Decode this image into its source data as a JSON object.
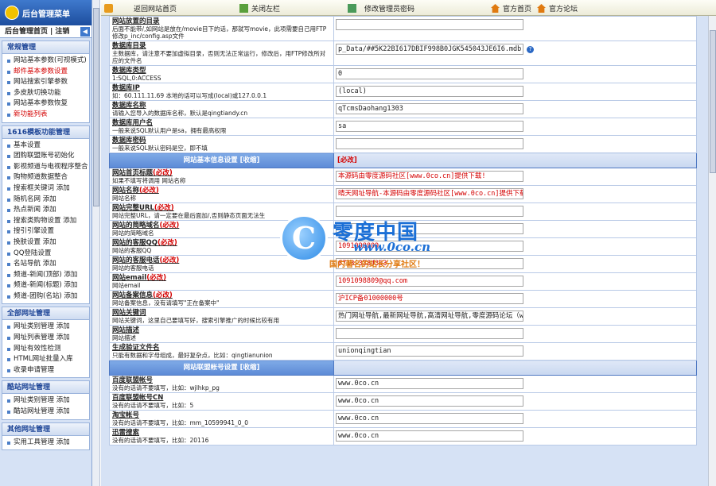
{
  "sidebar": {
    "header": "后台管理菜单",
    "home": "后台管理首页",
    "logout": "注销",
    "groups": [
      {
        "title": "常规管理",
        "items": [
          {
            "label": "网站基本参数(可视模式)",
            "red": false
          },
          {
            "label": "邮件基本参数设置",
            "red": true
          },
          {
            "label": "网站搜索引擎参数",
            "red": false
          },
          {
            "label": "多皮肤切换功能",
            "red": false
          },
          {
            "label": "网站基本参数恢复",
            "red": false
          },
          {
            "label": "新功能列表",
            "red": true
          }
        ]
      },
      {
        "title": "1616模板功能管理",
        "items": [
          {
            "label": "基本设置",
            "red": false
          },
          {
            "label": "团购联盟账号初始化",
            "red": false
          },
          {
            "label": "影视频道与电视程序整合",
            "red": false
          },
          {
            "label": "购物频道数据整合",
            "red": false
          },
          {
            "label": "搜索框关键词  添加",
            "red": false
          },
          {
            "label": "随机名网  添加",
            "red": false
          },
          {
            "label": "热点新闻  添加",
            "red": false
          },
          {
            "label": "搜索类购物设置  添加",
            "red": false
          },
          {
            "label": "搜引引擎设置",
            "red": false
          },
          {
            "label": "换肤设置  添加",
            "red": false
          },
          {
            "label": "QQ登陆设置",
            "red": false
          },
          {
            "label": "名站导航  添加",
            "red": false
          },
          {
            "label": "频道-新闻(顶部)  添加",
            "red": false
          },
          {
            "label": "频道-新闻(标题)  添加",
            "red": false
          },
          {
            "label": "频道-团购(名站)  添加",
            "red": false
          }
        ]
      },
      {
        "title": "全部网址管理",
        "items": [
          {
            "label": "网址类别管理  添加",
            "red": false
          },
          {
            "label": "网址列表管理  添加",
            "red": false
          },
          {
            "label": "网址有效性检测",
            "red": false
          },
          {
            "label": "HTML网址批量入库",
            "red": false
          },
          {
            "label": "收录申请管理",
            "red": false
          }
        ]
      },
      {
        "title": "酷站网址管理",
        "items": [
          {
            "label": "网址类别管理  添加",
            "red": false
          },
          {
            "label": "酷站网址管理  添加",
            "red": false
          }
        ]
      },
      {
        "title": "其他网址管理",
        "items": [
          {
            "label": "实用工具管理  添加",
            "red": false
          }
        ]
      }
    ]
  },
  "topbar": {
    "back": "返回网站首页",
    "close_left": "关闭左栏",
    "change_pwd": "修改管理员密码",
    "official_home": "官方首页",
    "official_forum": "官方论坛"
  },
  "rows": [
    {
      "kind": "field",
      "title": "网站放置的目录",
      "req": "",
      "desc": "后面不能带/,如网站是放在/movie目下的话，那就写movie，此项需要自己用FTP修改p_inc/config.asp文件",
      "value": "",
      "red": false,
      "help": false
    },
    {
      "kind": "field",
      "title": "数据库目录",
      "req": "",
      "desc": "主数据库，请注意不要加虚拟目录，否则无法正常运行，修改后，用FTP修改所对应的文件名",
      "value": "p_Data/##5K22BI617DBIF998B0JGK545043JE6I6.mdb",
      "red": false,
      "help": true
    },
    {
      "kind": "field",
      "title": "数据库类型",
      "req": "",
      "desc": "1:SQL,0:ACCESS",
      "value": "0",
      "red": false,
      "help": false
    },
    {
      "kind": "field",
      "title": "数据库IP",
      "req": "",
      "desc": "如：60.111.11.69 本地的话可以写成(local)或127.0.0.1",
      "value": "(local)",
      "red": false,
      "help": false
    },
    {
      "kind": "field",
      "title": "数据库名称",
      "req": "",
      "desc": "请输入您导入的数据库名称，默认是qingtiandy.cn",
      "value": "qTcmsDaohang1303",
      "red": false,
      "help": false
    },
    {
      "kind": "field",
      "title": "数据库用户名",
      "req": "",
      "desc": "一般来说SQL默认用户是sa，拥有最高权限",
      "value": "sa",
      "red": false,
      "help": false
    },
    {
      "kind": "field",
      "title": "数据库密码",
      "req": "",
      "desc": "一般来说SQL默认密码是空，即不填",
      "value": "",
      "red": false,
      "help": false
    },
    {
      "kind": "section",
      "left": "网站基本信息设置 [收缩]",
      "right": "[必改]"
    },
    {
      "kind": "field",
      "title": "网站首页标题",
      "req": "(必改)",
      "desc": "如果不填写将调用 网站名称",
      "value": "本源码由零度源码社区[www.0co.cn]提供下载!",
      "red": true,
      "help": false
    },
    {
      "kind": "field",
      "title": "网站名称",
      "req": "(必改)",
      "desc": "网站名称",
      "value": "晴天网址导航-本源码由零度源码社区[www.0co.cn]提供下载!",
      "red": true,
      "help": false
    },
    {
      "kind": "field",
      "title": "网站完整URL",
      "req": "(必改)",
      "desc": "网站完整URL，请一定要在最后面加/,否则静态页面无法生",
      "value": "",
      "red": false,
      "help": false
    },
    {
      "kind": "field",
      "title": "网站的简略域名",
      "req": "(必改)",
      "desc": "网站的简略域名",
      "value": "",
      "red": false,
      "help": false
    },
    {
      "kind": "field",
      "title": "网站的客服QQ",
      "req": "(必改)",
      "desc": "网站的客服QQ",
      "value": "1091098809",
      "red": true,
      "help": false
    },
    {
      "kind": "field",
      "title": "网站的客服电话",
      "req": "(必改)",
      "desc": "网站的客服电话",
      "value": "0713-3384363",
      "red": true,
      "help": false
    },
    {
      "kind": "field",
      "title": "网站email",
      "req": "(必改)",
      "desc": "网站email",
      "value": "1091098809@qq.com",
      "red": true,
      "help": false
    },
    {
      "kind": "field",
      "title": "网站备案信息",
      "req": "(必改)",
      "desc": "网站备案信息，没有请填写\"正在备案中\"",
      "value": "沪ICP备01000000号",
      "red": true,
      "help": false
    },
    {
      "kind": "field",
      "title": "网站关键词",
      "req": "",
      "desc": "网站关键词，这里自己要填写好，搜索引擎推广的时候比较有用",
      "value": "热门网址导航,最新网址导航,高清网址导航,零度源码论坛（www",
      "red": false,
      "help": false
    },
    {
      "kind": "field",
      "title": "网站描述",
      "req": "",
      "desc": "网站描述",
      "value": "",
      "red": false,
      "help": false
    },
    {
      "kind": "field",
      "title": "生成验证文件名",
      "req": "",
      "desc": "只能有数据和字母组成，最好复杂点，比如：qingtianunion",
      "value": "unionqingtian",
      "red": false,
      "help": false
    },
    {
      "kind": "section",
      "left": "网站联盟帐号设置 [收缩]",
      "right": ""
    },
    {
      "kind": "field",
      "title": "百度联盟帐号",
      "req": "",
      "desc": "没有的话请不要填写，比如：wjlhkp_pg",
      "value": "www.0co.cn",
      "red": false,
      "help": false
    },
    {
      "kind": "field",
      "title": "百度联盟帐号CN",
      "req": "",
      "desc": "没有的话请不要填写，比如：5",
      "value": "www.0co.cn",
      "red": false,
      "help": false
    },
    {
      "kind": "field",
      "title": "淘宝帐号",
      "req": "",
      "desc": "没有的话请不要填写，比如：mm_10599941_0_0",
      "value": "www.0co.cn",
      "red": false,
      "help": false
    },
    {
      "kind": "field",
      "title": "迅雷搜索",
      "req": "",
      "desc": "没有的话请不要填写，比如：20116",
      "value": "www.0co.cn",
      "red": false,
      "help": false
    }
  ],
  "watermark": {
    "glyph": "C",
    "cn": "零度中国",
    "url": "www.0co.cn",
    "slogan": "国内著名的站长分享社区！"
  }
}
